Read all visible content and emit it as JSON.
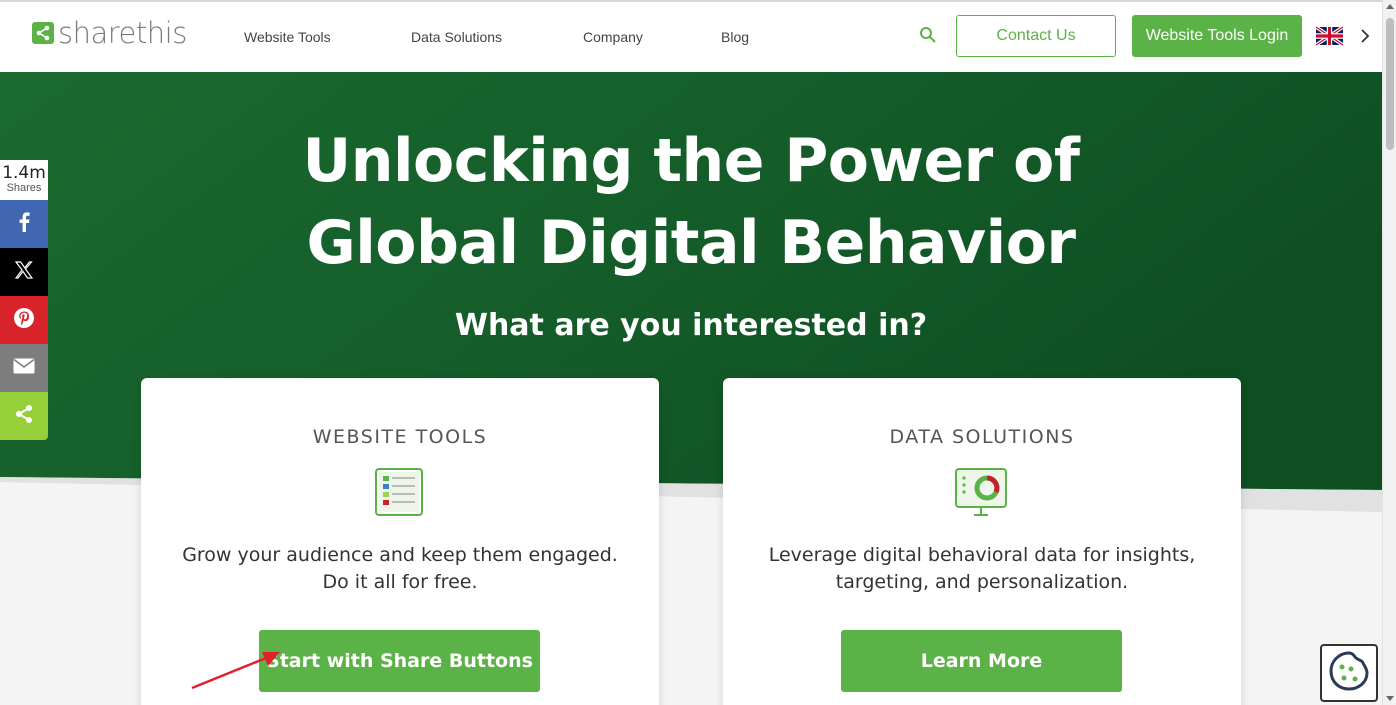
{
  "header": {
    "logo_text": "sharethis",
    "nav": [
      "Website Tools",
      "Data Solutions",
      "Company",
      "Blog"
    ],
    "contact_label": "Contact Us",
    "login_label": "Website Tools Login"
  },
  "hero": {
    "title_line1": "Unlocking the Power of",
    "title_line2": "Global Digital Behavior",
    "subtitle": "What are you interested in?"
  },
  "cards": [
    {
      "title": "WEBSITE TOOLS",
      "desc_line1": "Grow your audience and keep them engaged.",
      "desc_line2": "Do it all for free.",
      "button": "Start with Share Buttons"
    },
    {
      "title": "DATA SOLUTIONS",
      "desc_line1": "Leverage digital behavioral data for insights,",
      "desc_line2": "targeting, and personalization.",
      "button": "Learn More"
    }
  ],
  "share_bar": {
    "count": "1.4m",
    "count_label": "Shares",
    "buttons": [
      {
        "name": "facebook",
        "color": "#4267b2"
      },
      {
        "name": "x",
        "color": "#000000"
      },
      {
        "name": "pinterest",
        "color": "#e60023"
      },
      {
        "name": "email",
        "color": "#7d7d7d"
      },
      {
        "name": "sharethis",
        "color": "#95d03a"
      }
    ]
  },
  "colors": {
    "brand_green": "#5bb246",
    "hero_green": "#165b2c"
  }
}
